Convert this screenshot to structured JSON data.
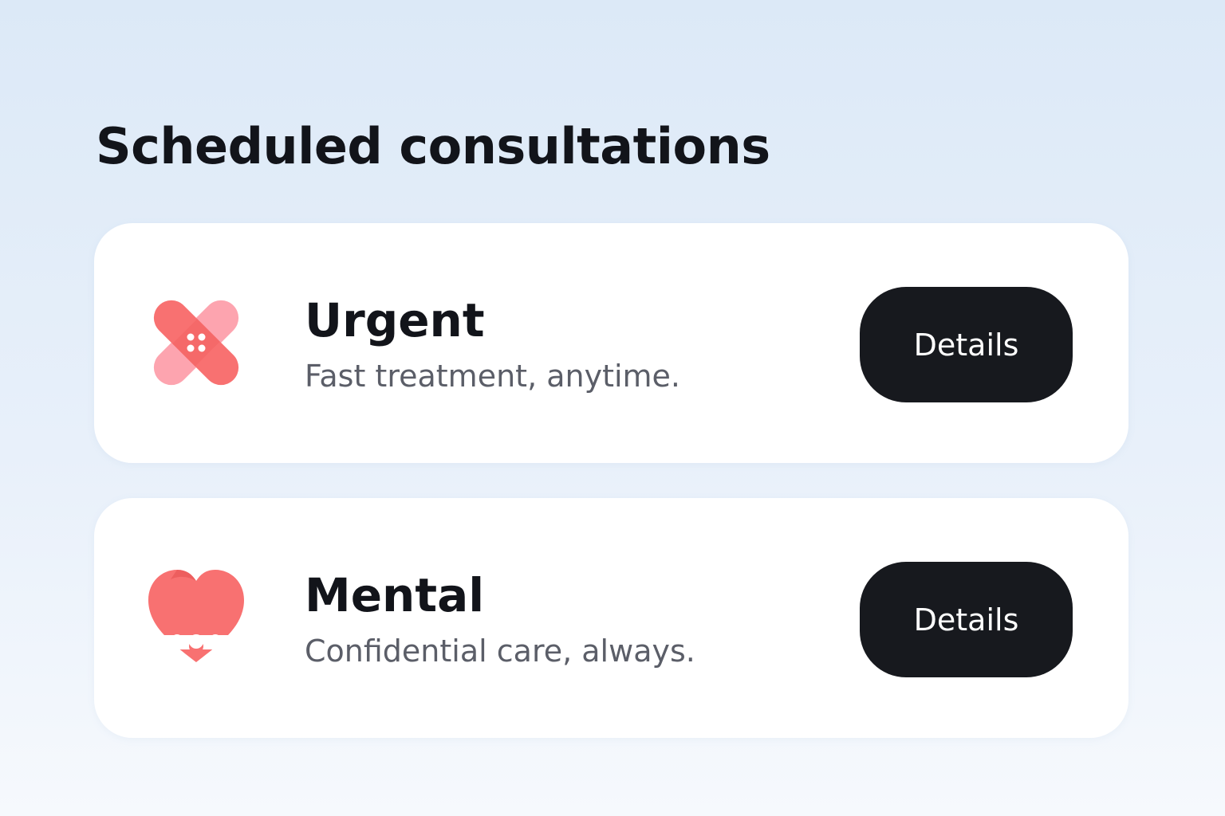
{
  "page": {
    "title": "Scheduled consultations"
  },
  "consultations": [
    {
      "title": "Urgent",
      "subtitle": "Fast treatment, anytime.",
      "button_label": "Details",
      "icon": "bandage-icon"
    },
    {
      "title": "Mental",
      "subtitle": "Confidential care, always.",
      "button_label": "Details",
      "icon": "heart-icon"
    }
  ],
  "colors": {
    "background_top": "#dce9f7",
    "background_bottom": "#f6f9fd",
    "card": "#ffffff",
    "button": "#17191e",
    "button_text": "#ffffff",
    "title_text": "#12141a",
    "subtitle_text": "#5b5e68",
    "icon_coral": "#f87171",
    "icon_pink": "#fda4af"
  }
}
